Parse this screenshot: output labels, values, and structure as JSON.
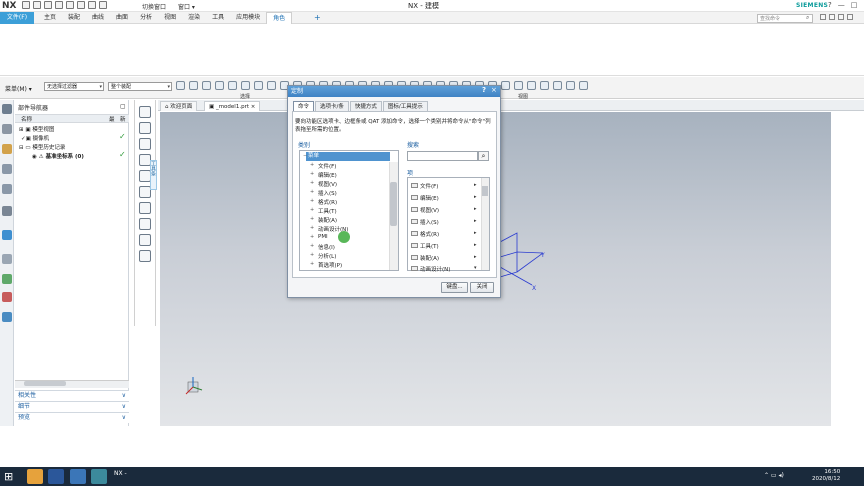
{
  "title_bar": {
    "logo": "NX",
    "switch_window": "切换窗口",
    "window_menu": "窗口 ▾",
    "app_title": "NX - 建模",
    "brand": "SIEMENS",
    "controls": [
      "?",
      "—",
      "□",
      "×"
    ]
  },
  "menubar": {
    "file_menu": "文件(F)",
    "tabs": [
      "主页",
      "装配",
      "曲线",
      "曲面",
      "分析",
      "视图",
      "渲染",
      "工具",
      "应用模块",
      "角色"
    ],
    "active_tab": "角色",
    "plus": "+",
    "search_placeholder": "查找命令"
  },
  "selection_bar": {
    "menu_label": "菜单(M) ▾",
    "filter": "无选择过滤器",
    "scope": "整个装配",
    "selection_group": "选择",
    "view_group": "视图"
  },
  "navigator": {
    "title": "部件导航器",
    "col_name": "名称",
    "col_latest": "最",
    "col_flag": "新",
    "items": [
      {
        "label": "模型视图",
        "check": ""
      },
      {
        "label": "摄像机",
        "check": "✓"
      },
      {
        "label": "模型历史记录",
        "check": ""
      },
      {
        "label": "基准坐标系 (0)",
        "check": "✓"
      }
    ],
    "panels": [
      "相关性",
      "细节",
      "预览"
    ]
  },
  "document_tabs": {
    "welcome": "欢迎页面",
    "model": "_model1.prt",
    "close": "×"
  },
  "vertical_tab": "工具条",
  "dialog": {
    "title": "定制",
    "help": "?",
    "close": "×",
    "tabs": [
      "命令",
      "选项卡/条",
      "快捷方式",
      "图标/工具提示"
    ],
    "active_tab": "命令",
    "description": "要向功能区选项卡、边框条或 QAT 添加命令，选择一个类别并将命令从\"命令\"列表拖至所需的位置。",
    "category_label": "类别",
    "categories": [
      "菜单",
      "文件(F)",
      "编辑(E)",
      "视图(V)",
      "插入(S)",
      "格式(R)",
      "工具(T)",
      "装配(A)",
      "动画设计(N)",
      "PMI",
      "信息(I)",
      "分析(L)",
      "首选项(P)"
    ],
    "search_label": "搜索",
    "items_label": "项",
    "items": [
      "文件(F)",
      "编辑(E)",
      "视图(V)",
      "插入(S)",
      "格式(R)",
      "工具(T)",
      "装配(A)",
      "动画设计(N)"
    ],
    "keyboard_button": "键盘...",
    "close_button": "关闭"
  },
  "taskbar": {
    "start": "⊞",
    "window_label": "NX -",
    "time": "16:50",
    "date": "2020/8/12"
  }
}
